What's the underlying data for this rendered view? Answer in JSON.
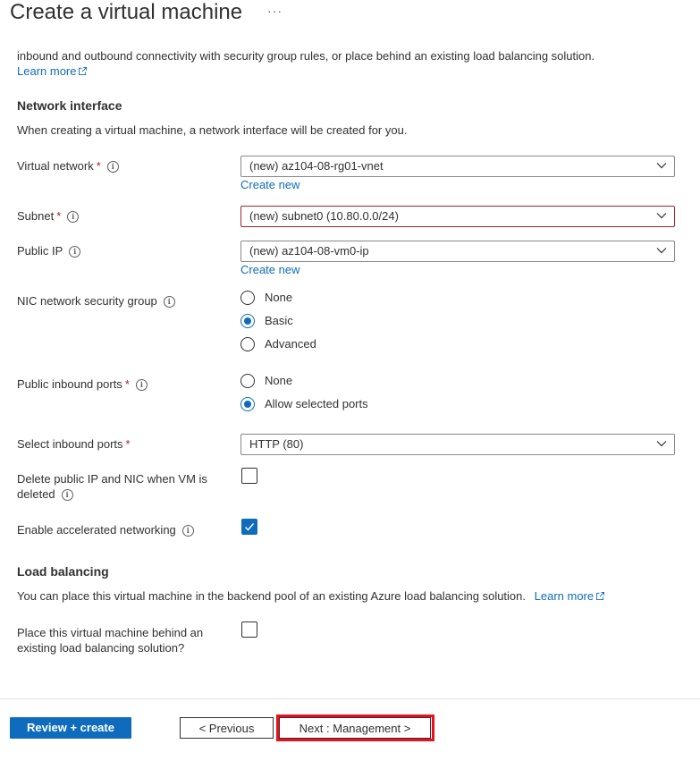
{
  "header": {
    "title": "Create a virtual machine",
    "more": "···"
  },
  "intro": {
    "text": "inbound and outbound connectivity with security group rules, or place behind an existing load balancing solution.",
    "learn_more": "Learn more"
  },
  "network_interface": {
    "heading": "Network interface",
    "description": "When creating a virtual machine, a network interface will be created for you.",
    "virtual_network": {
      "label": "Virtual network",
      "required": "*",
      "value": "(new) az104-08-rg01-vnet",
      "create_new": "Create new"
    },
    "subnet": {
      "label": "Subnet",
      "required": "*",
      "value": "(new) subnet0 (10.80.0.0/24)"
    },
    "public_ip": {
      "label": "Public IP",
      "value": "(new) az104-08-vm0-ip",
      "create_new": "Create new"
    },
    "nic_nsg": {
      "label": "NIC network security group",
      "options": [
        "None",
        "Basic",
        "Advanced"
      ],
      "selected": "Basic"
    },
    "public_inbound_ports": {
      "label": "Public inbound ports",
      "required": "*",
      "options": [
        "None",
        "Allow selected ports"
      ],
      "selected": "Allow selected ports"
    },
    "select_inbound_ports": {
      "label": "Select inbound ports",
      "required": "*",
      "value": "HTTP (80)"
    },
    "delete_public_ip": {
      "label_line1": "Delete public IP and NIC when VM is",
      "label_line2": "deleted",
      "checked": false
    },
    "accelerated_networking": {
      "label": "Enable accelerated networking",
      "checked": true
    }
  },
  "load_balancing": {
    "heading": "Load balancing",
    "description": "You can place this virtual machine in the backend pool of an existing Azure load balancing solution.",
    "learn_more": "Learn more",
    "place_behind": {
      "label_line1": "Place this virtual machine behind an",
      "label_line2": "existing load balancing solution?",
      "checked": false
    }
  },
  "footer": {
    "review_create": "Review + create",
    "previous": "< Previous",
    "next": "Next : Management >"
  },
  "colors": {
    "accent": "#0f6cbd",
    "required": "#a4262c",
    "highlight": "#e8111d"
  }
}
